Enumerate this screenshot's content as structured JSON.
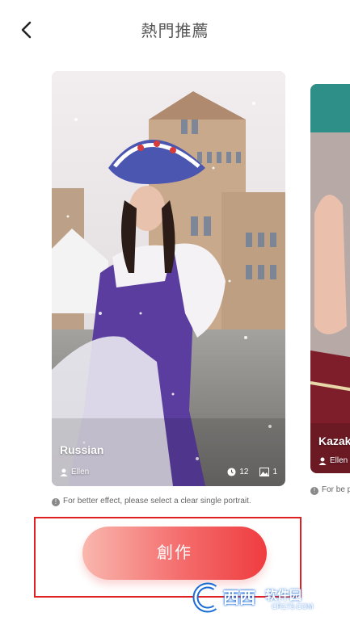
{
  "header": {
    "title": "熱門推薦"
  },
  "cards": [
    {
      "name": "Russian",
      "author": "Ellen",
      "count_time": "12",
      "count_images": "1"
    },
    {
      "name": "Kazak",
      "author": "Ellen"
    }
  ],
  "hint": {
    "text": "For better effect, please select a clear single portrait.",
    "text_next": "For be portra"
  },
  "create_button": {
    "label": "創作"
  },
  "watermark": {
    "brand": "西西",
    "sub": "软件园",
    "url": "CR173.COM"
  },
  "colors": {
    "accent": "#ef3c3f",
    "highlight_box": "#e02020"
  }
}
